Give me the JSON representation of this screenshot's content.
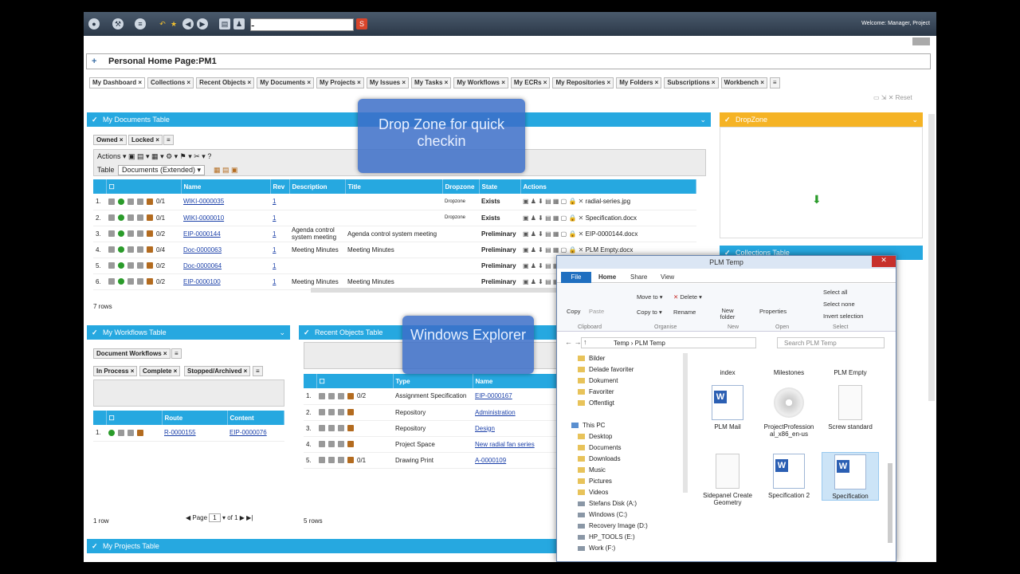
{
  "topbar": {
    "welcome": "Welcome: Manager, Project",
    "search_value": "-"
  },
  "page": {
    "title": "Personal Home Page:PM1"
  },
  "tabs": [
    "My Dashboard",
    "Collections",
    "Recent Objects",
    "My Documents",
    "My Projects",
    "My Issues",
    "My Tasks",
    "My Workflows",
    "My ECRs",
    "My Repositories",
    "My Folders",
    "Subscriptions",
    "Workbench"
  ],
  "reset_label": "Reset",
  "documents": {
    "title": "My Documents Table",
    "subtabs": [
      "Owned",
      "Locked"
    ],
    "actions_label": "Actions",
    "table_label": "Table",
    "table_select": "Documents (Extended)",
    "columns": [
      "Name",
      "Rev",
      "Description",
      "Title",
      "Dropzone",
      "State",
      "Actions"
    ],
    "rows": [
      {
        "n": "1.",
        "ver": "0/1",
        "name": "WIKI-0000035",
        "rev": "1",
        "desc": "",
        "title": "",
        "drop": "Dropzone",
        "state": "Exists",
        "file": "radial-series.jpg"
      },
      {
        "n": "2.",
        "ver": "0/1",
        "name": "WIKI-0000010",
        "rev": "1",
        "desc": "",
        "title": "",
        "drop": "Dropzone",
        "state": "Exists",
        "file": "Specification.docx"
      },
      {
        "n": "3.",
        "ver": "0/2",
        "name": "EIP-0000144",
        "rev": "1",
        "desc": "Agenda control system meeting",
        "title": "Agenda control system meeting",
        "drop": "",
        "state": "Preliminary",
        "file": "EIP-0000144.docx"
      },
      {
        "n": "4.",
        "ver": "0/4",
        "name": "Doc-0000063",
        "rev": "1",
        "desc": "Meeting Minutes",
        "title": "Meeting Minutes",
        "drop": "",
        "state": "Preliminary",
        "file": "PLM Empty.docx"
      },
      {
        "n": "5.",
        "ver": "0/2",
        "name": "Doc-0000064",
        "rev": "1",
        "desc": "",
        "title": "",
        "drop": "",
        "state": "Preliminary",
        "file": ""
      },
      {
        "n": "6.",
        "ver": "0/2",
        "name": "EIP-0000100",
        "rev": "1",
        "desc": "Meeting Minutes",
        "title": "Meeting Minutes",
        "drop": "",
        "state": "Preliminary",
        "file": ""
      }
    ],
    "count": "7 rows"
  },
  "dropzone": {
    "title": "DropZone"
  },
  "collections": {
    "title": "Collections Table"
  },
  "callouts": {
    "dropzone": "Drop Zone for quick checkin",
    "explorer": "Windows Explorer"
  },
  "workflows": {
    "title": "My Workflows Table",
    "subtab": "Document Workflows",
    "filters": [
      "In Process",
      "Complete",
      "Stopped/Archived"
    ],
    "columns": [
      "Route",
      "Content"
    ],
    "rows": [
      {
        "n": "1.",
        "route": "R-0000155",
        "content": "EIP-0000076"
      }
    ],
    "count": "1 row",
    "page_label": "Page",
    "page_num": "1",
    "page_of": "of 1"
  },
  "recent": {
    "title": "Recent Objects Table",
    "columns": [
      "Type",
      "Name"
    ],
    "rows": [
      {
        "n": "1.",
        "ver": "0/2",
        "type": "Assignment Specification",
        "name": "EIP-0000167"
      },
      {
        "n": "2.",
        "ver": "",
        "type": "Repository",
        "name": "Administration"
      },
      {
        "n": "3.",
        "ver": "",
        "type": "Repository",
        "name": "Design"
      },
      {
        "n": "4.",
        "ver": "",
        "type": "Project Space",
        "name": "New radial fan series"
      },
      {
        "n": "5.",
        "ver": "0/1",
        "type": "Drawing Print",
        "name": "A-0000109"
      }
    ],
    "count": "5 rows"
  },
  "projects": {
    "title": "My Projects Table"
  },
  "explorer": {
    "title": "PLM Temp",
    "tabs": {
      "file": "File",
      "home": "Home",
      "share": "Share",
      "view": "View"
    },
    "ribbon": {
      "copy": "Copy",
      "paste": "Paste",
      "move_to": "Move to",
      "copy_to": "Copy to",
      "delete": "Delete",
      "rename": "Rename",
      "new_folder": "New folder",
      "properties": "Properties",
      "select_all": "Select all",
      "select_none": "Select none",
      "invert": "Invert selection",
      "g_clipboard": "Clipboard",
      "g_organise": "Organise",
      "g_new": "New",
      "g_open": "Open",
      "g_select": "Select"
    },
    "path": [
      "Temp",
      "PLM Temp"
    ],
    "search_placeholder": "Search PLM Temp",
    "tree": [
      {
        "label": "Bilder",
        "kind": "folder"
      },
      {
        "label": "Delade favoriter",
        "kind": "folder"
      },
      {
        "label": "Dokument",
        "kind": "folder"
      },
      {
        "label": "Favoriter",
        "kind": "folder"
      },
      {
        "label": "Offentligt",
        "kind": "folder"
      },
      {
        "label": "",
        "kind": "gap"
      },
      {
        "label": "This PC",
        "kind": "pc"
      },
      {
        "label": "Desktop",
        "kind": "folder"
      },
      {
        "label": "Documents",
        "kind": "folder"
      },
      {
        "label": "Downloads",
        "kind": "folder"
      },
      {
        "label": "Music",
        "kind": "folder"
      },
      {
        "label": "Pictures",
        "kind": "folder"
      },
      {
        "label": "Videos",
        "kind": "folder"
      },
      {
        "label": "Stefans Disk (A:)",
        "kind": "drive"
      },
      {
        "label": "Windows (C:)",
        "kind": "drive"
      },
      {
        "label": "Recovery Image (D:)",
        "kind": "drive"
      },
      {
        "label": "HP_TOOLS (E:)",
        "kind": "drive"
      },
      {
        "label": "Work (F:)",
        "kind": "drive"
      }
    ],
    "files_top": [
      "index",
      "Milestones",
      "PLM Empty"
    ],
    "files": [
      {
        "label": "PLM Mail",
        "icon": "word"
      },
      {
        "label": "ProjectProfession al_x86_en-us",
        "icon": "disc"
      },
      {
        "label": "Screw standard",
        "icon": "blank"
      },
      {
        "label": "Sidepanel Create Geometry",
        "icon": "blank"
      },
      {
        "label": "Specification 2",
        "icon": "word"
      },
      {
        "label": "Specification",
        "icon": "word"
      }
    ]
  }
}
